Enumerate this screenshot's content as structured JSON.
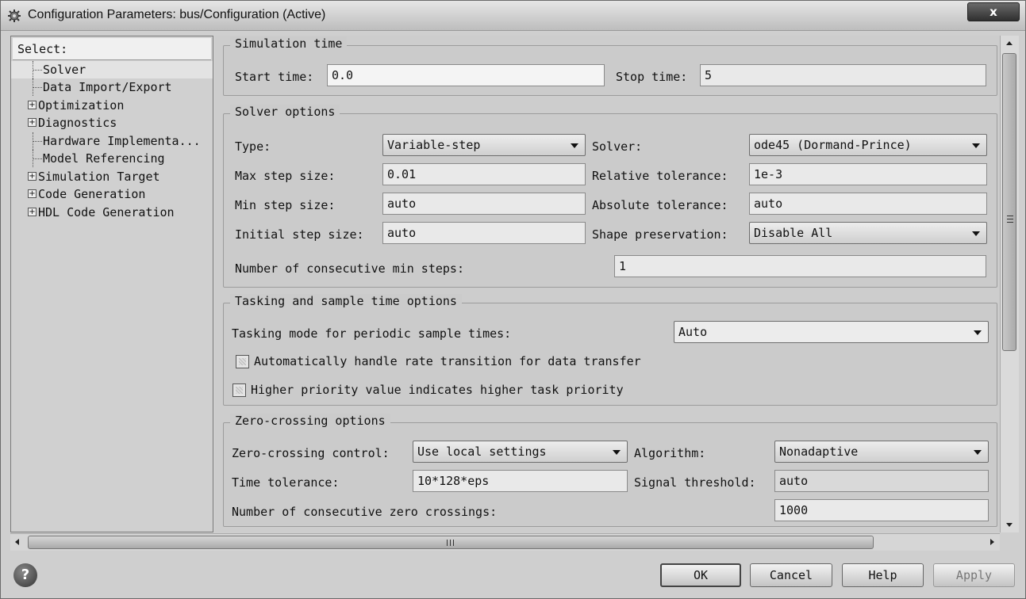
{
  "window": {
    "title": "Configuration Parameters: bus/Configuration (Active)",
    "close_label": "x"
  },
  "tree": {
    "header": "Select:",
    "items": [
      {
        "label": "Solver",
        "expandable": false,
        "selected": true
      },
      {
        "label": "Data Import/Export",
        "expandable": false,
        "selected": false
      },
      {
        "label": "Optimization",
        "expandable": true,
        "selected": false
      },
      {
        "label": "Diagnostics",
        "expandable": true,
        "selected": false
      },
      {
        "label": "Hardware Implementa...",
        "expandable": false,
        "selected": false
      },
      {
        "label": "Model Referencing",
        "expandable": false,
        "selected": false
      },
      {
        "label": "Simulation Target",
        "expandable": true,
        "selected": false
      },
      {
        "label": "Code Generation",
        "expandable": true,
        "selected": false
      },
      {
        "label": "HDL Code Generation",
        "expandable": true,
        "selected": false
      }
    ]
  },
  "simulation_time": {
    "legend": "Simulation time",
    "start_label": "Start time:",
    "start_value": "0.0",
    "stop_label": "Stop time:",
    "stop_value": "5"
  },
  "solver_options": {
    "legend": "Solver options",
    "type_label": "Type:",
    "type_value": "Variable-step",
    "solver_label": "Solver:",
    "solver_value": "ode45 (Dormand-Prince)",
    "max_step_label": "Max step size:",
    "max_step_value": "0.01",
    "rel_tol_label": "Relative tolerance:",
    "rel_tol_value": "1e-3",
    "min_step_label": "Min step size:",
    "min_step_value": "auto",
    "abs_tol_label": "Absolute tolerance:",
    "abs_tol_value": "auto",
    "init_step_label": "Initial step size:",
    "init_step_value": "auto",
    "shape_label": "Shape preservation:",
    "shape_value": "Disable All",
    "consec_min_label": "Number of consecutive min steps:",
    "consec_min_value": "1"
  },
  "tasking": {
    "legend": "Tasking and sample time options",
    "mode_label": "Tasking mode for periodic sample times:",
    "mode_value": "Auto",
    "rate_transition_label": "Automatically handle rate transition for data transfer",
    "rate_transition_checked": false,
    "priority_label": "Higher priority value indicates higher task priority",
    "priority_checked": false
  },
  "zero_crossing": {
    "legend": "Zero-crossing options",
    "control_label": "Zero-crossing control:",
    "control_value": "Use local settings",
    "algorithm_label": "Algorithm:",
    "algorithm_value": "Nonadaptive",
    "time_tol_label": "Time tolerance:",
    "time_tol_value": "10*128*eps",
    "signal_label": "Signal threshold:",
    "signal_value": "auto",
    "consec_zc_label": "Number of consecutive zero crossings:",
    "consec_zc_value": "1000"
  },
  "buttons": {
    "help_icon": "?",
    "ok": "OK",
    "cancel": "Cancel",
    "help": "Help",
    "apply": "Apply"
  },
  "scroll": {
    "h_grip": "III",
    "v_grip": "≡"
  }
}
